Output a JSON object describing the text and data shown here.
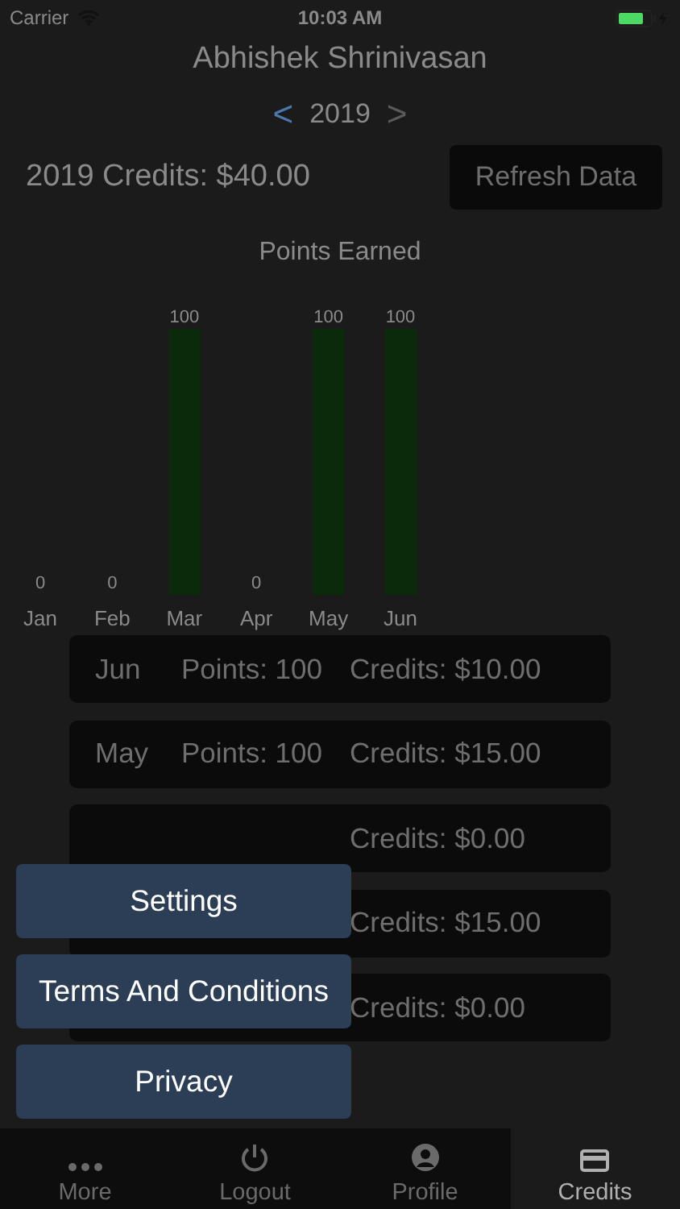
{
  "status_bar": {
    "carrier": "Carrier",
    "time": "10:03 AM"
  },
  "header": {
    "title": "Abhishek Shrinivasan",
    "prev": "<",
    "year": "2019",
    "next": ">"
  },
  "summary": {
    "credits": "2019 Credits: $40.00",
    "refresh_button": "Refresh Data"
  },
  "chart": {
    "chart_data": {
      "type": "bar",
      "title": "Points Earned",
      "categories": [
        "Jan",
        "Feb",
        "Mar",
        "Apr",
        "May",
        "Jun"
      ],
      "series": [
        {
          "color": "#0b2a0b",
          "values": [
            0,
            0,
            100,
            0,
            100,
            100
          ]
        }
      ],
      "ylim": [
        0,
        100
      ],
      "data_labels": true
    }
  },
  "months": [
    {
      "month": "Jun",
      "points": "Points: 100",
      "credits": "Credits: $10.00"
    },
    {
      "month": "May",
      "points": "Points: 100",
      "credits": "Credits: $15.00"
    },
    {
      "credits": "Credits: $0.00"
    },
    {
      "credits": "Credits: $15.00"
    },
    {
      "credits": "Credits: $0.00"
    }
  ],
  "menu": [
    "Settings",
    "Terms And Conditions",
    "Privacy"
  ],
  "tab_bar": [
    {
      "label": "More",
      "selected": false
    },
    {
      "label": "Logout",
      "selected": false
    },
    {
      "label": "Profile",
      "selected": false
    },
    {
      "label": "Credits",
      "selected": true
    }
  ]
}
